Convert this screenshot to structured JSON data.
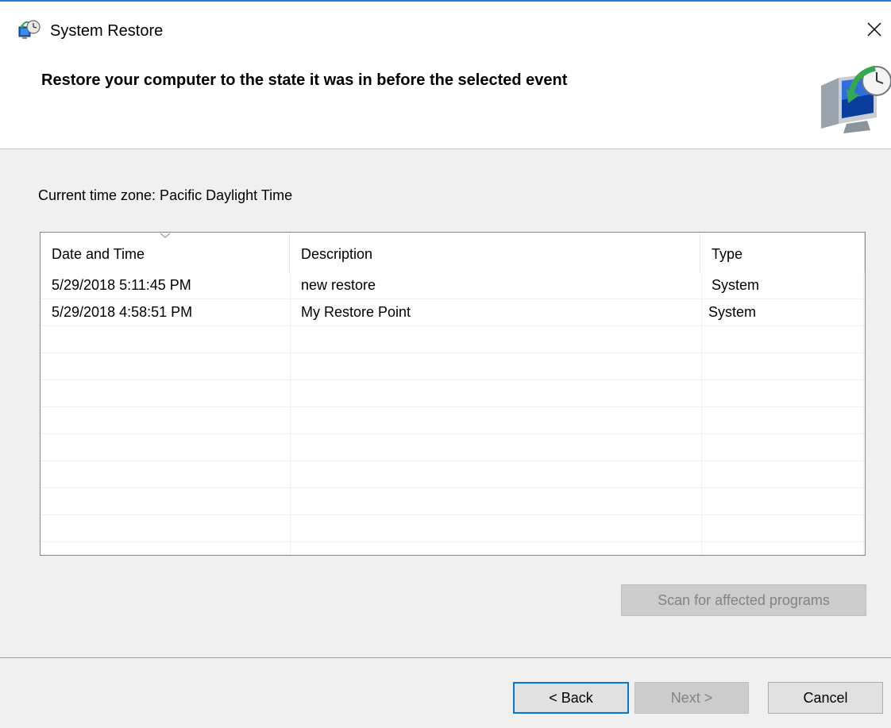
{
  "window": {
    "title": "System Restore",
    "close_glyph": "✕",
    "header_title": "Restore your computer to the state it was in before the selected event"
  },
  "main": {
    "timezone_label": "Current time zone: Pacific Daylight Time",
    "table": {
      "columns": [
        "Date and Time",
        "Description",
        "Type"
      ],
      "rows": [
        {
          "date": "5/29/2018 5:11:45 PM",
          "description": "new restore",
          "type": "System"
        },
        {
          "date": "5/29/2018 4:58:51 PM",
          "description": "My Restore Point",
          "type": "System"
        }
      ]
    },
    "scan_button": "Scan for affected programs"
  },
  "footer": {
    "back_label": "< Back",
    "next_label": "Next >",
    "cancel_label": "Cancel"
  },
  "colors": {
    "accent": "#2b7bd6",
    "default_button_border": "#0078d7",
    "body_background": "#f0f0f0"
  },
  "icons": {
    "app": "system-restore-icon",
    "header": "restore-computer-icon",
    "close": "close-icon",
    "sort": "chevron-down-icon"
  }
}
